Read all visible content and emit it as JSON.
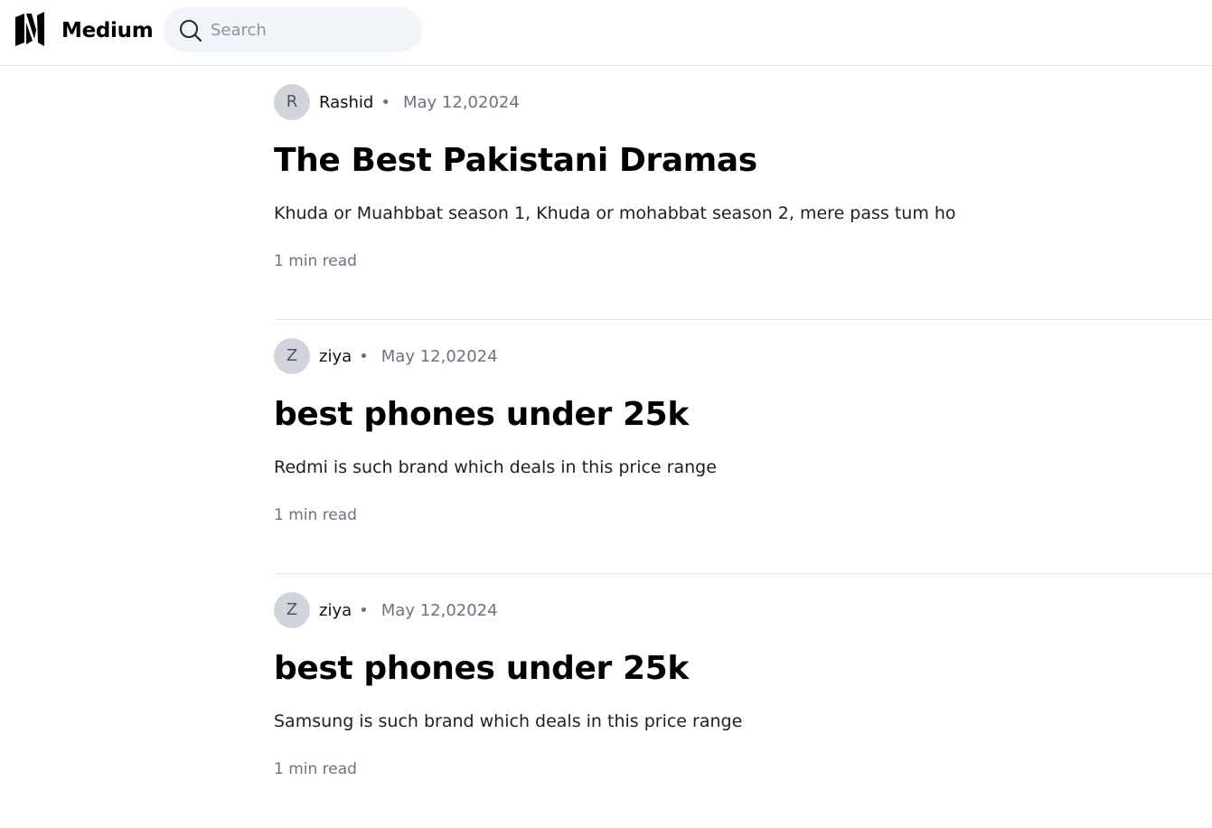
{
  "header": {
    "brand": "Medium",
    "search": {
      "placeholder": "Search",
      "value": ""
    },
    "icons": {
      "logo": "medium-logo-icon",
      "search": "search-icon"
    }
  },
  "posts": [
    {
      "avatar_initial": "R",
      "author": "Rashid",
      "separator": "•",
      "date": "May 12,02024",
      "title": "The Best Pakistani Dramas",
      "description": "Khuda or Muahbbat season 1, Khuda or mohabbat season 2, mere pass tum ho",
      "read_time": "1 min read"
    },
    {
      "avatar_initial": "Z",
      "author": "ziya",
      "separator": "•",
      "date": "May 12,02024",
      "title": "best phones under 25k",
      "description": "Redmi is such brand which deals in this price range",
      "read_time": "1 min read"
    },
    {
      "avatar_initial": "Z",
      "author": "ziya",
      "separator": "•",
      "date": "May 12,02024",
      "title": "best phones under 25k",
      "description": "Samsung is such brand which deals in this price range",
      "read_time": "1 min read"
    }
  ],
  "colors": {
    "search_bg": "#f1f4f8",
    "avatar_bg": "#d1d5db",
    "muted_text": "#6b7280",
    "divider": "#e5e7eb"
  }
}
